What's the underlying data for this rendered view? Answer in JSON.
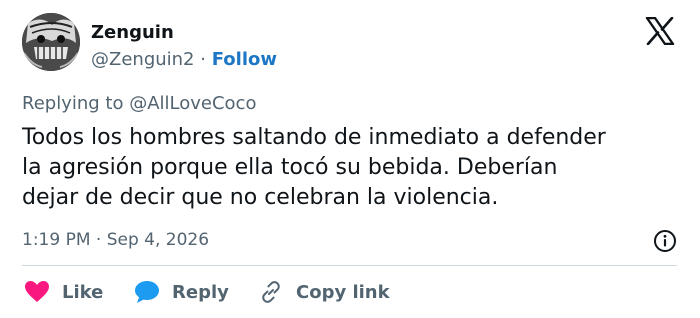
{
  "author": {
    "name": "Zenguin",
    "handle": "@Zenguin2",
    "separator": "·",
    "follow_label": "Follow"
  },
  "reply_context": "Replying to @AllLoveCoco",
  "tweet": {
    "lines": [
      "Todos los hombres saltando de inmediato a defender",
      "la agresión porque ella tocó su bebida. Deberían",
      "dejar de decir que no celebran la violencia."
    ]
  },
  "timestamp": "1:19 PM · Sep 4, 2026",
  "actions": {
    "like_label": "Like",
    "reply_label": "Reply",
    "copy_label": "Copy link"
  },
  "icons": {
    "logo": "x-logo-icon",
    "info": "info-icon",
    "like": "heart-icon",
    "reply": "speech-bubble-icon",
    "copy": "link-icon"
  },
  "colors": {
    "like": "#f91880",
    "reply": "#1d9bf0",
    "follow": "#1d77c4",
    "muted": "#536471",
    "text": "#0f1419",
    "divider": "#cfd9de"
  }
}
